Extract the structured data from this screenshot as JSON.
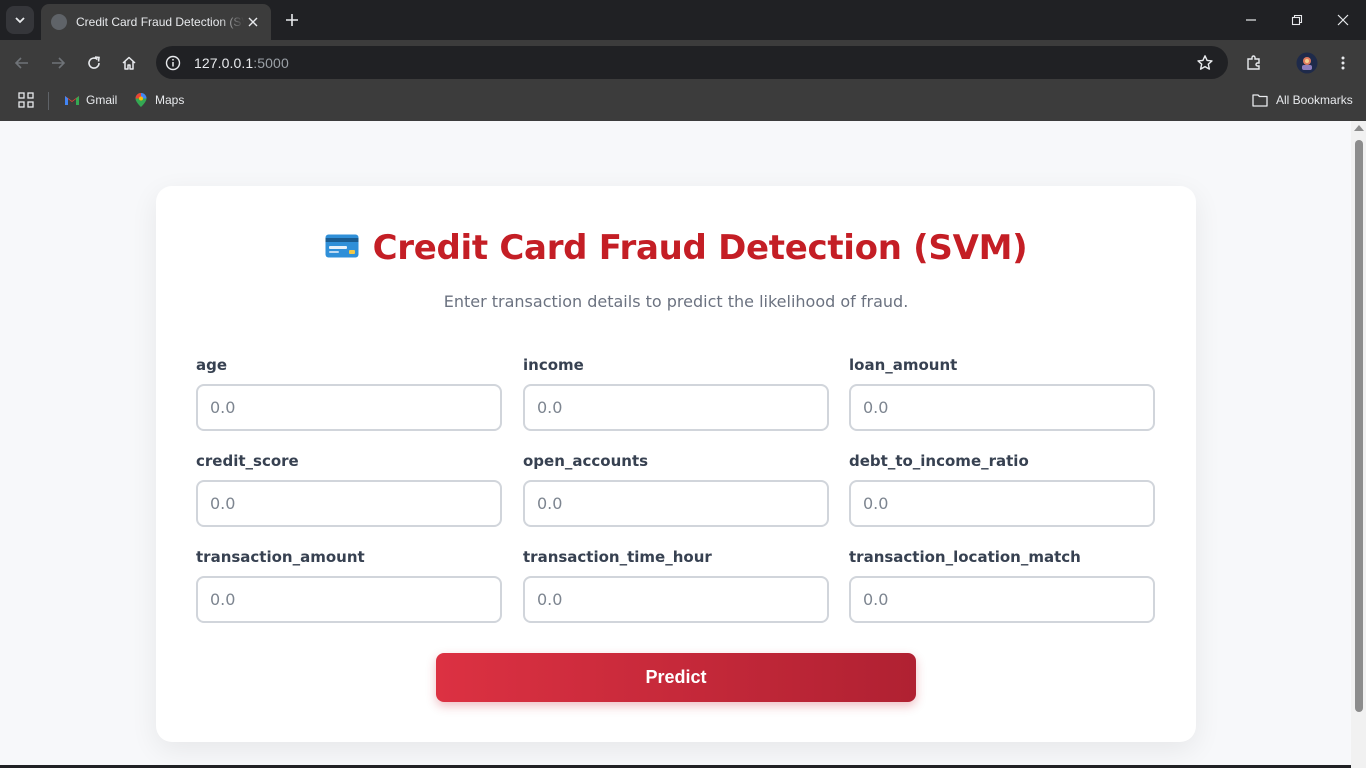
{
  "browser": {
    "tab_title": "Credit Card Fraud Detection (SVM)",
    "url_host": "127.0.0.1",
    "url_port": ":5000",
    "bookmarks": [
      {
        "label": "Gmail",
        "icon": "gmail-icon"
      },
      {
        "label": "Maps",
        "icon": "maps-icon"
      }
    ],
    "all_bookmarks_label": "All Bookmarks"
  },
  "page": {
    "title_icon": "credit-card-icon",
    "title": "Credit Card Fraud Detection (SVM)",
    "subtitle": "Enter transaction details to predict the likelihood of fraud.",
    "fields": [
      {
        "label": "age",
        "placeholder": "0.0"
      },
      {
        "label": "income",
        "placeholder": "0.0"
      },
      {
        "label": "loan_amount",
        "placeholder": "0.0"
      },
      {
        "label": "credit_score",
        "placeholder": "0.0"
      },
      {
        "label": "open_accounts",
        "placeholder": "0.0"
      },
      {
        "label": "debt_to_income_ratio",
        "placeholder": "0.0"
      },
      {
        "label": "transaction_amount",
        "placeholder": "0.0"
      },
      {
        "label": "transaction_time_hour",
        "placeholder": "0.0"
      },
      {
        "label": "transaction_location_match",
        "placeholder": "0.0"
      }
    ],
    "predict_label": "Predict"
  },
  "colors": {
    "title": "#c41e25",
    "button_start": "#dc3142",
    "button_end": "#b02132"
  }
}
